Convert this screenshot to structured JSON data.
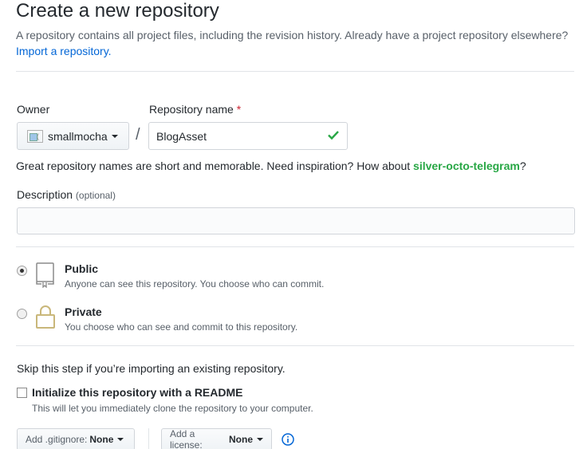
{
  "page": {
    "title": "Create a new repository",
    "subhead_text": "A repository contains all project files, including the revision history. Already have a project repository elsewhere?",
    "import_link": "Import a repository."
  },
  "owner": {
    "label": "Owner",
    "avatar_alt": "(",
    "value": "smallmocha"
  },
  "repo": {
    "label": "Repository name",
    "required_mark": "*",
    "value": "BlogAsset",
    "separator": "/"
  },
  "hint": {
    "text": "Great repository names are short and memorable. Need inspiration? How about ",
    "suggestion": "silver-octo-telegram",
    "suffix": "?"
  },
  "description": {
    "label": "Description",
    "optional": "(optional)",
    "value": ""
  },
  "visibility": {
    "selected": "public",
    "public_title": "Public",
    "public_note": "Anyone can see this repository. You choose who can commit.",
    "private_title": "Private",
    "private_note": "You choose who can see and commit to this repository."
  },
  "init": {
    "skip_text": "Skip this step if you’re importing an existing repository.",
    "readme_label": "Initialize this repository with a README",
    "readme_note": "This will let you immediately clone the repository to your computer.",
    "readme_checked": false
  },
  "options": {
    "gitignore_prefix": "Add .gitignore:",
    "gitignore_value": "None",
    "license_prefix": "Add a license:",
    "license_value": "None"
  },
  "colors": {
    "link": "#0366d6",
    "success": "#28a745",
    "required": "#cb2431",
    "private_lock": "#c9b77a"
  }
}
